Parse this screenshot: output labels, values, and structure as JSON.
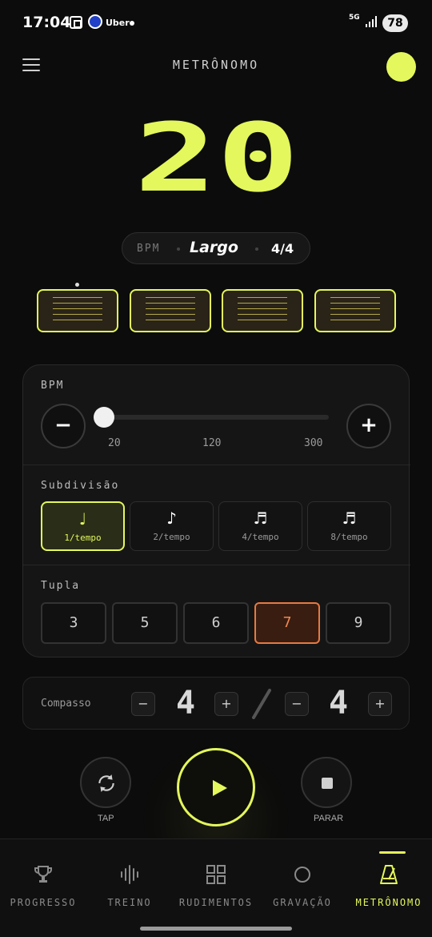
{
  "status_bar": {
    "time": "17:04",
    "app_badge": "Uber",
    "network": "5G",
    "battery": "78"
  },
  "header": {
    "title": "METRÔNOMO",
    "accent_color": "#e4f75c"
  },
  "tempo": {
    "bpm_value": "20",
    "bpm_label": "BPM",
    "tempo_name": "Largo",
    "time_signature": "4/4"
  },
  "beats": {
    "count": 4,
    "current_beat": 1
  },
  "bpm_control": {
    "label": "BPM",
    "minus_label": "−",
    "plus_label": "+",
    "min": "20",
    "mid": "120",
    "max": "300",
    "value": 20
  },
  "subdivision": {
    "label": "Subdivisão",
    "options": [
      {
        "glyph": "♩",
        "caption": "1/tempo",
        "active": true
      },
      {
        "glyph": "♪",
        "caption": "2/tempo",
        "active": false
      },
      {
        "glyph": "♬",
        "caption": "4/tempo",
        "active": false
      },
      {
        "glyph": "♬",
        "caption": "8/tempo",
        "active": false
      }
    ]
  },
  "tuplet": {
    "label": "Tupla",
    "options": [
      "3",
      "5",
      "6",
      "7",
      "9"
    ],
    "selected": "7"
  },
  "compasso": {
    "label": "Compasso",
    "numerator": "4",
    "denominator": "4",
    "minus": "−",
    "plus": "+"
  },
  "transport": {
    "tap_label": "TAP",
    "stop_label": "PARAR"
  },
  "nav": {
    "items": [
      {
        "label": "PROGRESSO",
        "icon": "trophy-icon"
      },
      {
        "label": "TREINO",
        "icon": "waveform-icon"
      },
      {
        "label": "RUDIMENTOS",
        "icon": "grid-icon"
      },
      {
        "label": "GRAVAÇÃO",
        "icon": "record-circle-icon"
      },
      {
        "label": "METRÔNOMO",
        "icon": "metronome-icon"
      }
    ],
    "active": "METRÔNOMO"
  }
}
